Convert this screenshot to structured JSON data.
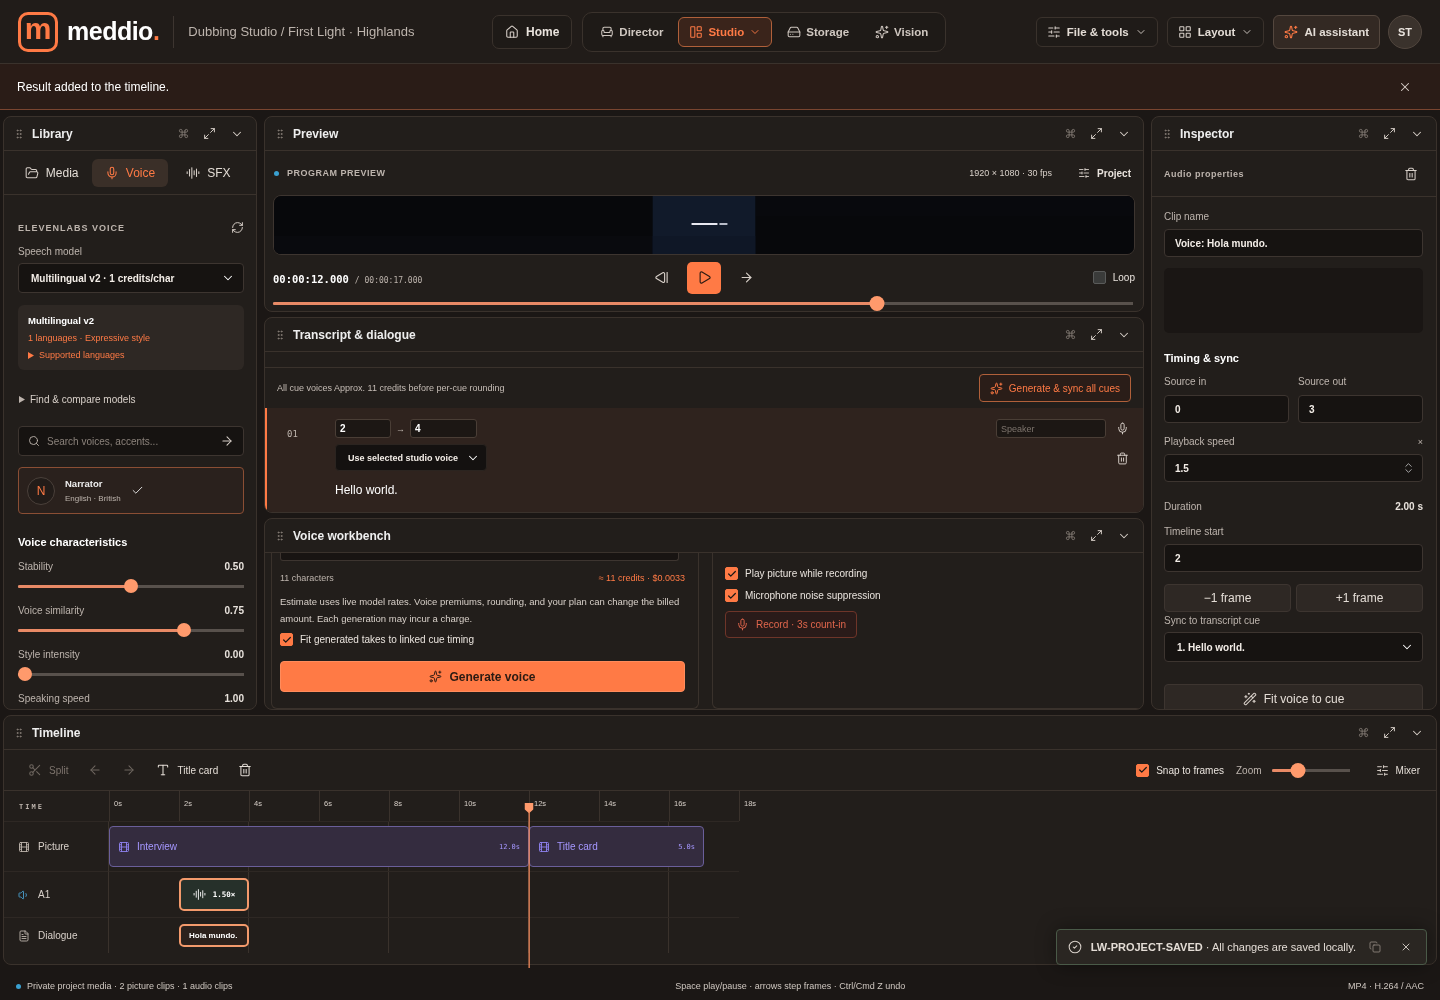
{
  "brand": {
    "mark": "m",
    "name": "meddio",
    "suffix": "."
  },
  "breadcrumb": "Dubbing Studio / First Light · Highlands",
  "home": "Home",
  "nav": [
    {
      "label": "Director",
      "kind": "chair",
      "selected": false,
      "menu": false
    },
    {
      "label": "Studio",
      "kind": "layout",
      "selected": true,
      "menu": true
    },
    {
      "label": "Storage",
      "kind": "drive",
      "selected": false,
      "menu": false
    },
    {
      "label": "Vision",
      "kind": "sparkles",
      "selected": false,
      "menu": false
    }
  ],
  "tools": [
    {
      "label": "File & tools",
      "kind": "sliders"
    },
    {
      "label": "Layout",
      "kind": "grid"
    },
    {
      "label": "AI assistant",
      "kind": "assistant"
    }
  ],
  "avatar": "ST",
  "banner": "Result added to the timeline.",
  "library": {
    "title": "Library",
    "tabs": [
      {
        "label": "Media",
        "kind": "folder",
        "selected": false
      },
      {
        "label": "Voice",
        "kind": "mic",
        "selected": true
      },
      {
        "label": "SFX",
        "kind": "wave",
        "selected": false
      }
    ],
    "section": "ELEVENLABS VOICE",
    "model_label": "Speech model",
    "model_value": "Multilingual v2 · 1 credits/char",
    "model_card": {
      "title": "Multilingual v2",
      "meta": "1 languages · Expressive style",
      "link": "Supported languages"
    },
    "find_link": "Find & compare models",
    "search_placeholder": "Search voices, accents...",
    "voice": {
      "initial": "N",
      "name": "Narrator",
      "meta": "English · British",
      "selected": true
    },
    "characteristics": "Voice characteristics",
    "sliders": [
      {
        "label": "Stability",
        "reading": "0.50",
        "level": 0.5
      },
      {
        "label": "Voice similarity",
        "reading": "0.75",
        "level": 0.75
      },
      {
        "label": "Style intensity",
        "reading": "0.00",
        "level": 0
      },
      {
        "label": "Speaking speed",
        "reading": "1.00"
      }
    ]
  },
  "preview": {
    "title": "Preview",
    "label": "PROGRAM PREVIEW",
    "format": "1920 × 1080 · 30 fps",
    "project": "Project",
    "time": "00:00:12.000",
    "total": "/ 00:00:17.000",
    "loop": {
      "label": "Loop",
      "checked": false
    },
    "scrub": {
      "level": 0.706
    }
  },
  "transcript": {
    "title": "Transcript & dialogue",
    "note": "All cue voices Approx. 11 credits before per-cue rounding",
    "action": "Generate & sync all cues",
    "cues": [
      {
        "index": "01",
        "start": "2",
        "arrow": "→",
        "end": "4",
        "voice": "Use selected studio voice",
        "speaker_placeholder": "Speaker",
        "text": "Hello world.",
        "selected": true
      }
    ]
  },
  "workbench": {
    "title": "Voice workbench",
    "chars": "11 characters",
    "estimate": "≈ 11 credits · $0.0033",
    "disclaimer": "Estimate uses live model rates. Voice premiums, rounding, and your plan can change the billed amount. Each generation may incur a charge.",
    "fit": {
      "label": "Fit generated takes to linked cue timing",
      "checked": true
    },
    "generate": "Generate voice",
    "options": [
      {
        "label": "Play picture while recording",
        "checked": true
      },
      {
        "label": "Microphone noise suppression",
        "checked": true
      }
    ],
    "record": "Record · 3s count-in"
  },
  "inspector": {
    "title": "Inspector",
    "section": "Audio properties",
    "clip_label": "Clip name",
    "clip_name": "Voice: Hola mundo.",
    "timing": "Timing & sync",
    "source_in_label": "Source in",
    "source_in": "0",
    "source_out_label": "Source out",
    "source_out": "3",
    "speed_label": "Playback speed",
    "speed_reset": "×",
    "speed": "1.5",
    "duration_label": "Duration",
    "duration": "2.00 s",
    "start_label": "Timeline start",
    "start": "2",
    "frame_buttons": [
      "−1 frame",
      "+1 frame"
    ],
    "sync_label": "Sync to transcript cue",
    "sync_value": "1. Hello world.",
    "fit": "Fit voice to cue"
  },
  "timeline": {
    "title": "Timeline",
    "tools": [
      {
        "kind": "split",
        "label": "Split",
        "disabled": true
      },
      {
        "kind": "undo",
        "disabled": true
      },
      {
        "kind": "redo",
        "disabled": true
      },
      {
        "kind": "title",
        "label": "Title card",
        "disabled": false
      },
      {
        "kind": "delete",
        "disabled": false
      }
    ],
    "snap": {
      "label": "Snap to frames",
      "checked": true
    },
    "zoom": {
      "label": "Zoom",
      "level": 0.3
    },
    "mixer": "Mixer",
    "ruler": "TIME",
    "ticks": [
      "0s",
      "2s",
      "4s",
      "6s",
      "8s",
      "10s",
      "12s",
      "14s",
      "16s",
      "18s"
    ],
    "playhead": {
      "level": 0.667
    },
    "tracks": [
      {
        "name": "Picture",
        "kind": "picture",
        "clips": [
          {
            "label": "Interview",
            "duration": "12.0s"
          },
          {
            "label": "Title card",
            "duration": "5.0s"
          }
        ]
      },
      {
        "name": "A1",
        "kind": "audio",
        "clips": [
          {
            "label": "1.50×"
          }
        ]
      },
      {
        "name": "Dialogue",
        "kind": "dialogue",
        "clips": [
          {
            "label": "Hola mundo."
          }
        ]
      }
    ]
  },
  "toast": "**LW-PROJECT-SAVED** · All changes are saved locally.",
  "status": {
    "left": "Private project media · 2 picture clips · 1 audio clips",
    "center": "Space play/pause · arrows step frames · Ctrl/Cmd Z undo",
    "right": "MP4 · H.264 / AAC"
  }
}
